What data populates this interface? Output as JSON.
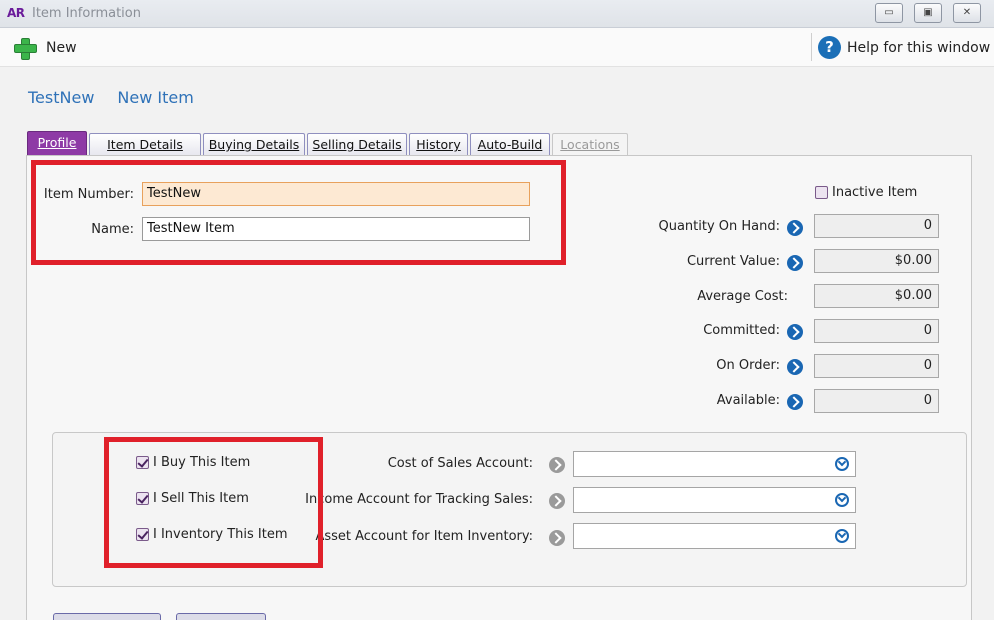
{
  "window": {
    "logo": "AR",
    "title": "Item Information",
    "minimize_glyph": "▭",
    "restore_glyph": "▣",
    "close_glyph": "✕"
  },
  "toolbar": {
    "new_label": "New",
    "new_icon": "plus-icon",
    "help_label": "Help for this window",
    "help_glyph": "?"
  },
  "breadcrumb": {
    "item_number": "TestNew",
    "state": "New Item"
  },
  "tabs": [
    {
      "label": "Profile",
      "active": true
    },
    {
      "label": "Item Details"
    },
    {
      "label": "Buying Details"
    },
    {
      "label": "Selling Details"
    },
    {
      "label": "History"
    },
    {
      "label": "Auto-Build"
    },
    {
      "label": "Locations",
      "disabled": true
    }
  ],
  "profile": {
    "item_number_label": "Item Number:",
    "item_number_value": "TestNew",
    "name_label": "Name:",
    "name_value": "TestNew Item",
    "inactive_label": "Inactive Item",
    "inactive_checked": false
  },
  "stats": [
    {
      "label": "Quantity On Hand:",
      "value": "0"
    },
    {
      "label": "Current Value:",
      "value": "$0.00"
    },
    {
      "label": "Average Cost:",
      "value": "$0.00"
    },
    {
      "label": "Committed:",
      "value": "0"
    },
    {
      "label": "On Order:",
      "value": "0"
    },
    {
      "label": "Available:",
      "value": "0"
    }
  ],
  "item_flags": [
    {
      "label": "I Buy This Item",
      "checked": true
    },
    {
      "label": "I Sell This Item",
      "checked": true
    },
    {
      "label": "I Inventory This Item",
      "checked": true
    }
  ],
  "accounts": [
    {
      "label": "Cost of Sales Account:",
      "value": ""
    },
    {
      "label": "Income Account for Tracking Sales:",
      "value": ""
    },
    {
      "label": "Asset Account for Item Inventory:",
      "value": ""
    }
  ],
  "colors": {
    "accent_tab": "#8e3aa6",
    "link_blue": "#2f72b8",
    "highlight_frame": "#e0202a",
    "focused_field": "#fde9d3"
  }
}
